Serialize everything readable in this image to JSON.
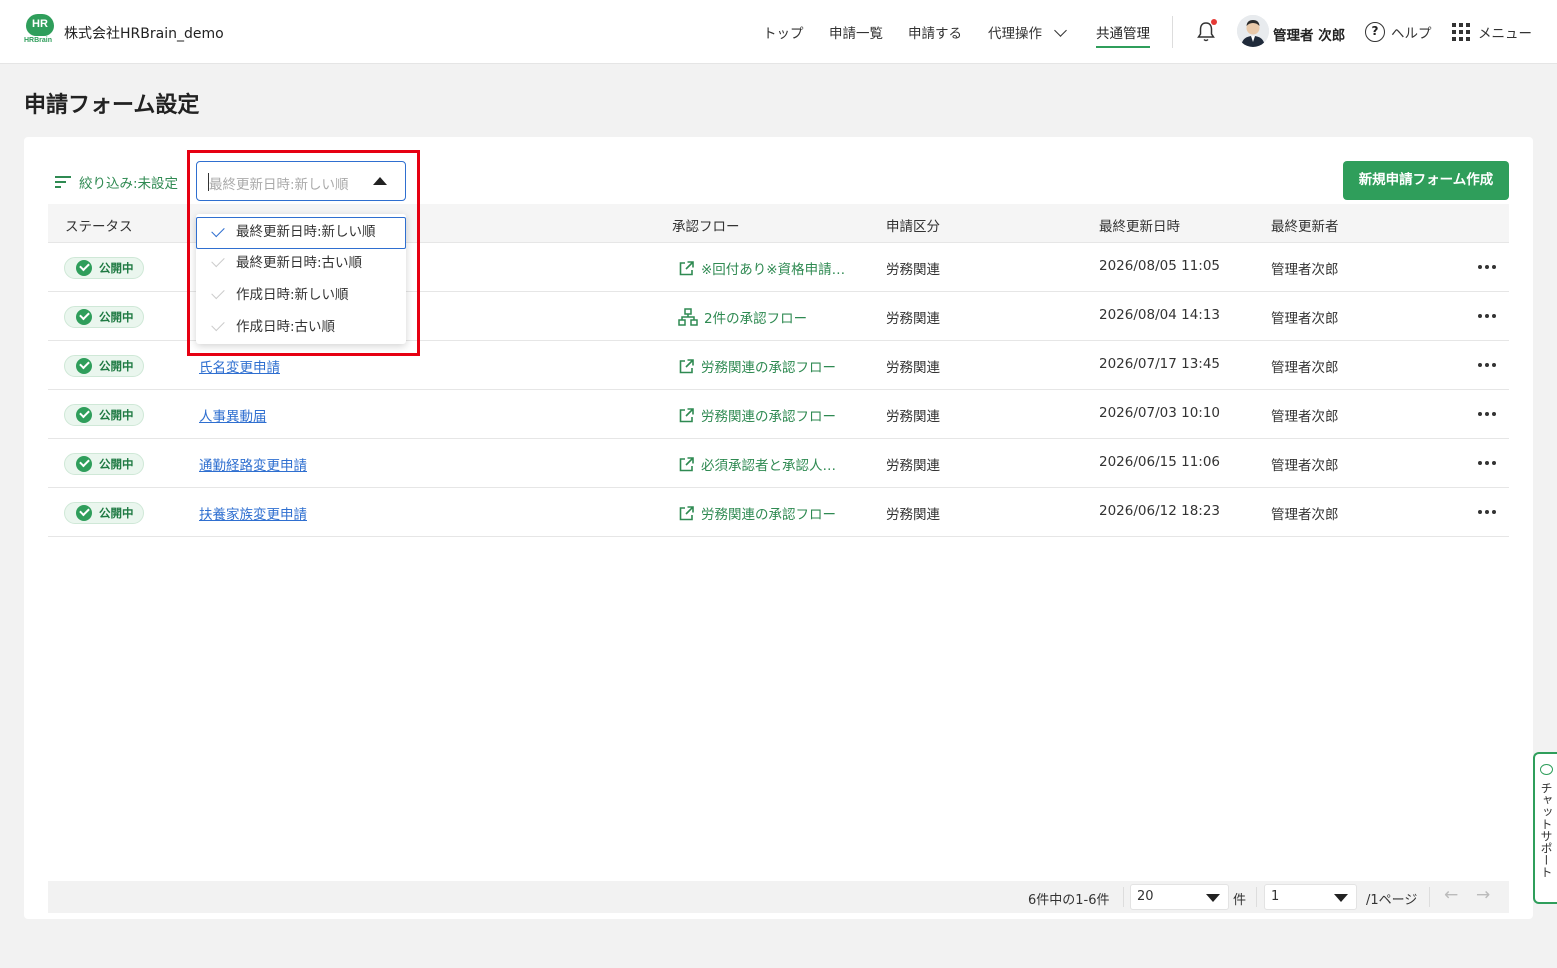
{
  "header": {
    "logo_text": "HR",
    "logo_sub": "HRBrain",
    "company": "株式会社HRBrain_demo",
    "nav": [
      "トップ",
      "申請一覧",
      "申請する",
      "代理操作",
      "共通管理"
    ],
    "active_nav": "共通管理",
    "user_name": "管理者 次郎",
    "help_label": "ヘルプ",
    "menu_label": "メニュー"
  },
  "page": {
    "title": "申請フォーム設定"
  },
  "toolbar": {
    "filter_label": "絞り込み:未設定",
    "sort_placeholder": "最終更新日時:新しい順",
    "new_button": "新規申請フォーム作成"
  },
  "sort_dropdown": {
    "options": [
      "最終更新日時:新しい順",
      "最終更新日時:古い順",
      "作成日時:新しい順",
      "作成日時:古い順"
    ],
    "selected_index": 0
  },
  "table": {
    "columns": [
      "ステータス",
      "",
      "承認フロー",
      "申請区分",
      "最終更新日時",
      "最終更新者"
    ],
    "rows": [
      {
        "status": "公開中",
        "name": "",
        "flow": "※回付あり※資格申請…",
        "flow_icon": "external-link-icon",
        "category": "労務関連",
        "updated": "2026/08/05 11:05",
        "updater": "管理者次郎"
      },
      {
        "status": "公開中",
        "name": "",
        "flow": "2件の承認フロー",
        "flow_icon": "org-chart-icon",
        "category": "労務関連",
        "updated": "2026/08/04 14:13",
        "updater": "管理者次郎"
      },
      {
        "status": "公開中",
        "name": "氏名変更申請",
        "flow": "労務関連の承認フロー",
        "flow_icon": "external-link-icon",
        "category": "労務関連",
        "updated": "2026/07/17 13:45",
        "updater": "管理者次郎"
      },
      {
        "status": "公開中",
        "name": "人事異動届",
        "flow": "労務関連の承認フロー",
        "flow_icon": "external-link-icon",
        "category": "労務関連",
        "updated": "2026/07/03 10:10",
        "updater": "管理者次郎"
      },
      {
        "status": "公開中",
        "name": "通勤経路変更申請",
        "flow": "必須承認者と承認人…",
        "flow_icon": "external-link-icon",
        "category": "労務関連",
        "updated": "2026/06/15 11:06",
        "updater": "管理者次郎"
      },
      {
        "status": "公開中",
        "name": "扶養家族変更申請",
        "flow": "労務関連の承認フロー",
        "flow_icon": "external-link-icon",
        "category": "労務関連",
        "updated": "2026/06/12 18:23",
        "updater": "管理者次郎"
      }
    ]
  },
  "pager": {
    "count_text": "6件中の1-6件",
    "per_page": "20",
    "per_page_unit": "件",
    "page": "1",
    "page_suffix": "/1ページ"
  },
  "chat": {
    "label": "チャットサポート"
  },
  "colors": {
    "brand_green": "#2f9e5b",
    "link_blue": "#2f6fd0",
    "highlight_red": "#e60012"
  }
}
